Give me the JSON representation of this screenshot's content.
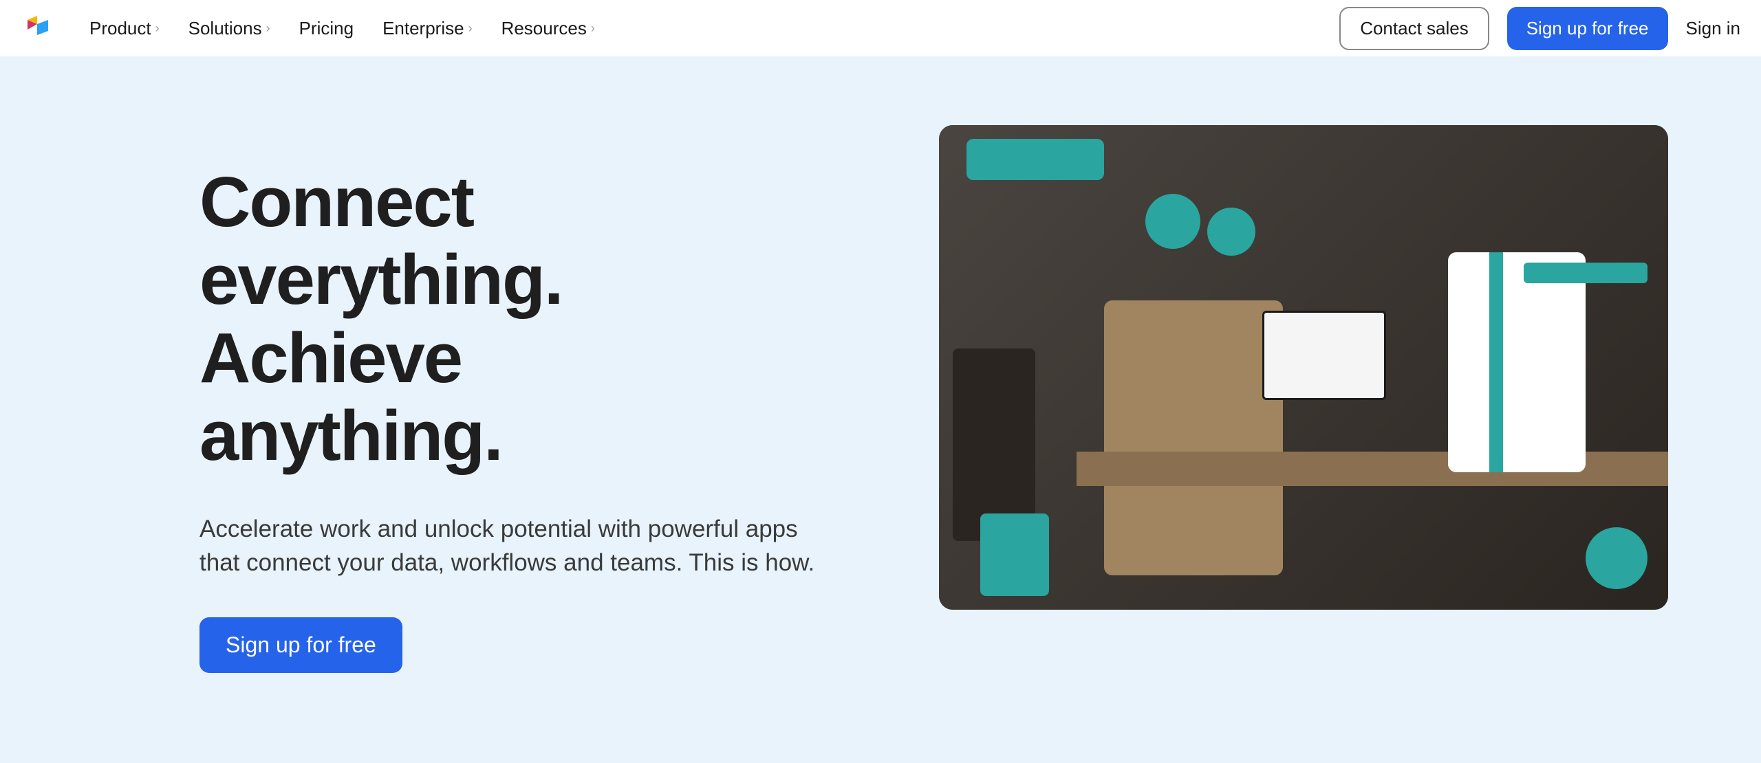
{
  "header": {
    "nav": [
      {
        "label": "Product",
        "has_chevron": true
      },
      {
        "label": "Solutions",
        "has_chevron": true
      },
      {
        "label": "Pricing",
        "has_chevron": false
      },
      {
        "label": "Enterprise",
        "has_chevron": true
      },
      {
        "label": "Resources",
        "has_chevron": true
      }
    ],
    "contact_sales": "Contact sales",
    "signup": "Sign up for free",
    "signin": "Sign in"
  },
  "hero": {
    "title_line1": "Connect",
    "title_line2": "everything.",
    "title_line3": "Achieve",
    "title_line4": "anything.",
    "subtitle": "Accelerate work and unlock potential with powerful apps that connect your data, workflows and teams. This is how.",
    "cta": "Sign up for free"
  },
  "colors": {
    "primary_blue": "#2563eb",
    "hero_bg": "#e8f3fb",
    "text_dark": "#1f1f1f"
  }
}
